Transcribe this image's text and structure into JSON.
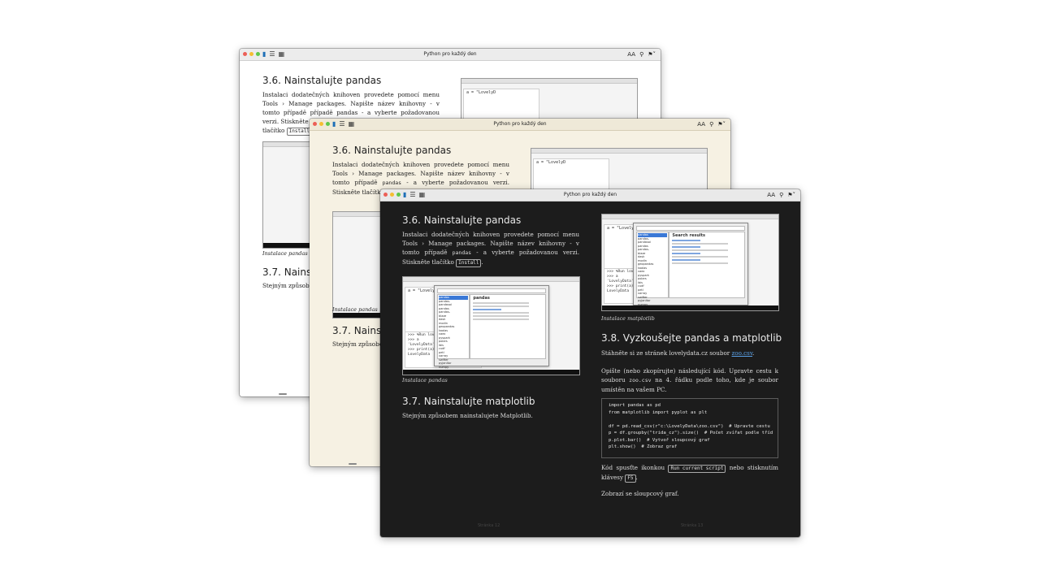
{
  "window": {
    "title": "Python pro každý den",
    "font_size_label": "AA",
    "search_icon": "search-icon",
    "bookmark_icon": "bookmark-icon"
  },
  "section_36": {
    "heading": "3.6. Nainstalujte pandas",
    "text_a": "Instalaci dodatečných knihoven provedete pomocí menu Tools ",
    "menu_sep": "›",
    "text_b": " Manage packages. Napište název knihovny - v tomto případě ",
    "pkg_word": "pandas",
    "text_c": " - a vyberte požadovanou verzi. Stiskněte tlačítko ",
    "install_key": "Install",
    "text_d": ".",
    "caption": "Instalace pandas"
  },
  "section_37": {
    "heading": "3.7. Nainstalujte matplotlib",
    "text": "Stejným způsobem nainstalujete Matplotlib.",
    "caption": "Instalace matplotlib",
    "w1_heading_partial": "3.7. Nainst",
    "w1_text_partial": "Stejným způsobem",
    "w2_heading_partial": "3.7. Nainst",
    "w2_text_partial": "Stejným způsobe"
  },
  "w1_partial": {
    "line3": "případě pandas - a vyberte požadovanou verzi. Stiskněte",
    "line4_a": "tlačítko ",
    "install": "Install"
  },
  "section_38": {
    "heading": "3.8. Vyzkoušejte pandas a matplotlib",
    "download_a": "Stáhněte si ze stránek lovelydata.cz soubor ",
    "download_link": "zoo.csv",
    "download_b": ".",
    "copy_text_a": "Opište (nebo zkopírujte) následující kód. Upravte cestu k souboru ",
    "copy_file": "zoo.csv",
    "copy_text_b": " na 4. řádku podle toho, kde je soubor umístěn na vašem PC.",
    "code_lines": [
      "import pandas as pd",
      "from matplotlib import pyplot as plt",
      "",
      "df = pd.read_csv(r\"c:\\LovelyData\\zoo.csv\")  # Upravte cestu",
      "p = df.groupby(\"trida_cz\").size()  # Počet zvířat podle tříd",
      "p.plot.bar()  # Vytvoř sloupcový graf",
      "plt.show()  # Zobraz graf"
    ],
    "run_a": "Kód spusťte ikonkou ",
    "run_button": "Run current script",
    "run_b": " nebo stisknutím klávesy ",
    "run_key": "F5",
    "run_c": ".",
    "result": "Zobrazí se sloupcový graf."
  },
  "screenshot": {
    "dialog_title": "Manage packages",
    "search_results": "Search results",
    "pkg_title": "pandas",
    "shell_lines": [
      ">>> %Run lovelydata",
      ">>> a",
      "'LovelyData'",
      ">>> print(a)",
      "LovelyData"
    ],
    "editor_line": "a = \"LovelyD",
    "list_items": [
      "pandas",
      "pandas-",
      "pandasai",
      "pandas",
      "pandas-",
      "blaze",
      "dask",
      "modin",
      "geopandas",
      "koalas",
      "vaex",
      "pyspark",
      "polars",
      "ibis",
      "cudf",
      "petl",
      "xarray",
      "swifter",
      "pyjanitor",
      "numpy"
    ]
  },
  "footer": {
    "left": "Stránka 12",
    "right": "Stránka 13"
  }
}
